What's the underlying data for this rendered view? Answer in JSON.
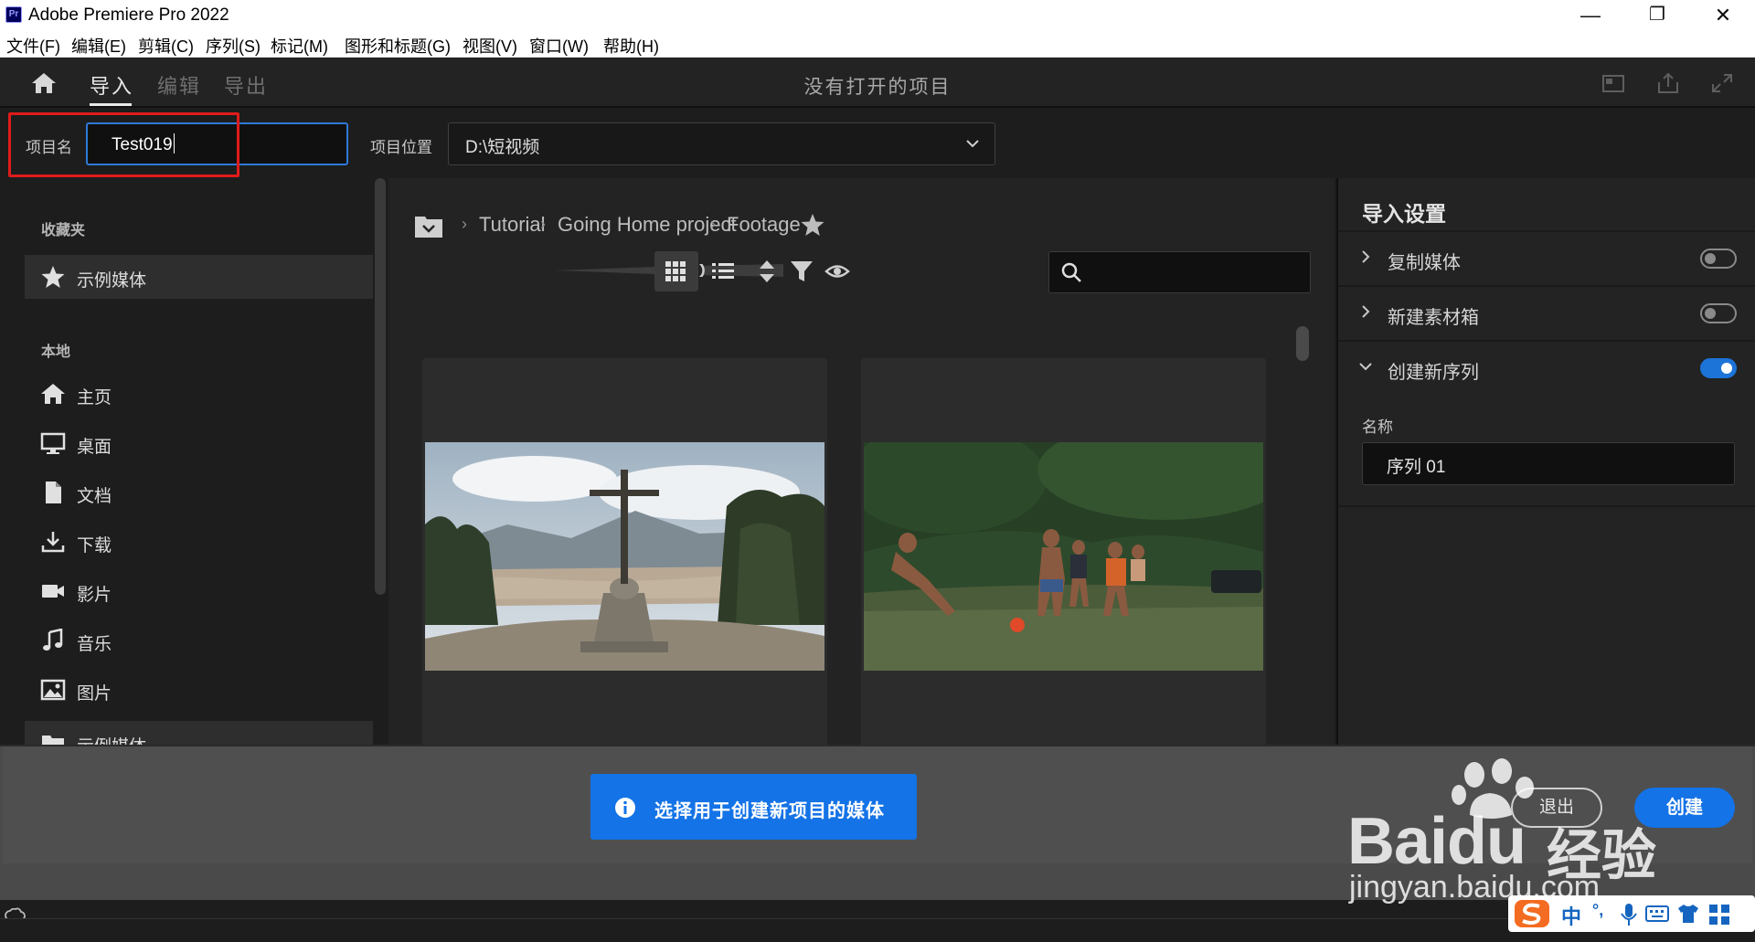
{
  "window": {
    "app_title": "Adobe Premiere Pro 2022",
    "app_icon_label": "Pr",
    "minimize": "—",
    "maximize": "❐",
    "close": "✕"
  },
  "menu": [
    "文件(F)",
    "编辑(E)",
    "剪辑(C)",
    "序列(S)",
    "标记(M)",
    "图形和标题(G)",
    "视图(V)",
    "窗口(W)",
    "帮助(H)"
  ],
  "header": {
    "tabs": [
      {
        "label": "导入",
        "active": true
      },
      {
        "label": "编辑",
        "active": false
      },
      {
        "label": "导出",
        "active": false
      }
    ],
    "center_title": "没有打开的项目"
  },
  "project": {
    "name_label": "项目名",
    "name_value": "Test019",
    "location_label": "项目位置",
    "location_value": "D:\\短视频"
  },
  "sidebar": {
    "favorites_title": "收藏夹",
    "favorites": [
      {
        "label": "示例媒体",
        "icon": "star-icon",
        "selected": true
      }
    ],
    "local_title": "本地",
    "local": [
      {
        "label": "主页",
        "icon": "home-icon"
      },
      {
        "label": "桌面",
        "icon": "desktop-icon"
      },
      {
        "label": "文档",
        "icon": "document-icon"
      },
      {
        "label": "下载",
        "icon": "download-icon"
      },
      {
        "label": "影片",
        "icon": "video-camera-icon"
      },
      {
        "label": "音乐",
        "icon": "music-icon"
      },
      {
        "label": "图片",
        "icon": "picture-icon"
      },
      {
        "label": "示例媒体",
        "icon": "folder-icon"
      }
    ]
  },
  "browser": {
    "breadcrumb": [
      "Tutorial",
      "Going Home project",
      "Footage"
    ],
    "zoom_level": 0.62,
    "search_placeholder": ""
  },
  "import_settings": {
    "title": "导入设置",
    "options": [
      {
        "label": "复制媒体",
        "expanded": false,
        "enabled": false
      },
      {
        "label": "新建素材箱",
        "expanded": false,
        "enabled": false
      },
      {
        "label": "创建新序列",
        "expanded": true,
        "enabled": true
      }
    ],
    "sequence_name_label": "名称",
    "sequence_name_value": "序列 01"
  },
  "footer": {
    "hint": "选择用于创建新项目的媒体",
    "exit_label": "退出",
    "create_label": "创建"
  },
  "watermark": {
    "brand": "Baidu",
    "brand_cn": "经验",
    "url": "jingyan.baidu.com"
  },
  "ime": {
    "lang": "中",
    "punct": "°,"
  },
  "colors": {
    "accent": "#1473e6",
    "highlight_box": "#e01b1b",
    "panel_bg": "#232323"
  }
}
